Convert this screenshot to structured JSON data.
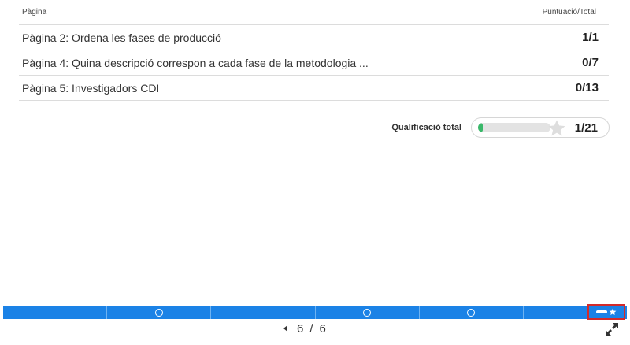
{
  "table": {
    "header_page": "Pàgina",
    "header_score": "Puntuació/Total",
    "rows": [
      {
        "title": "Pàgina 2: Ordena les fases de producció",
        "score": "1/1"
      },
      {
        "title": "Pàgina 4: Quina descripció correspon a cada fase de la metodologia ...",
        "score": "0/7"
      },
      {
        "title": "Pàgina 5: Investigadors CDI",
        "score": "0/13"
      }
    ]
  },
  "total": {
    "label": "Qualificació total",
    "value": "1/21",
    "progress_fraction": 0.0476,
    "fill_color": "#3ab86a"
  },
  "navigation": {
    "segments": 6,
    "dots_on_segments": [
      2,
      4,
      5
    ],
    "bar_color": "#1b82e6",
    "current_page": "6",
    "separator": "/",
    "total_pages": "6"
  },
  "icons": {
    "star": "star-icon",
    "prev": "caret-left-icon",
    "fullscreen": "expand-arrows-icon",
    "summary": "score-summary-icon"
  }
}
